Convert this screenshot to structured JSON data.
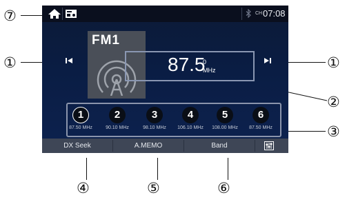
{
  "callouts": {
    "c1_left": "①",
    "c1_right": "①",
    "c2": "②",
    "c3": "③",
    "c4": "④",
    "c5": "⑤",
    "c6": "⑥",
    "c7": "⑦"
  },
  "status": {
    "ch_label": "CH",
    "time": "07:08"
  },
  "radio": {
    "band": "FM1",
    "frequency": "87.5",
    "freq_sup": "0",
    "unit": "MHz"
  },
  "presets": [
    {
      "num": "1",
      "freq": "87.50 MHz"
    },
    {
      "num": "2",
      "freq": "90.10 MHz"
    },
    {
      "num": "3",
      "freq": "98.10 MHz"
    },
    {
      "num": "4",
      "freq": "106.10 MHz"
    },
    {
      "num": "5",
      "freq": "108.00 MHz"
    },
    {
      "num": "6",
      "freq": "87.50 MHz"
    }
  ],
  "toolbar": {
    "dx_seek": "DX Seek",
    "amemo": "A.MEMO",
    "band": "Band"
  },
  "icons": [
    "home-icon",
    "source-icon",
    "bluetooth-icon",
    "previous-icon",
    "next-icon",
    "antenna-icon",
    "equalizer-icon"
  ]
}
